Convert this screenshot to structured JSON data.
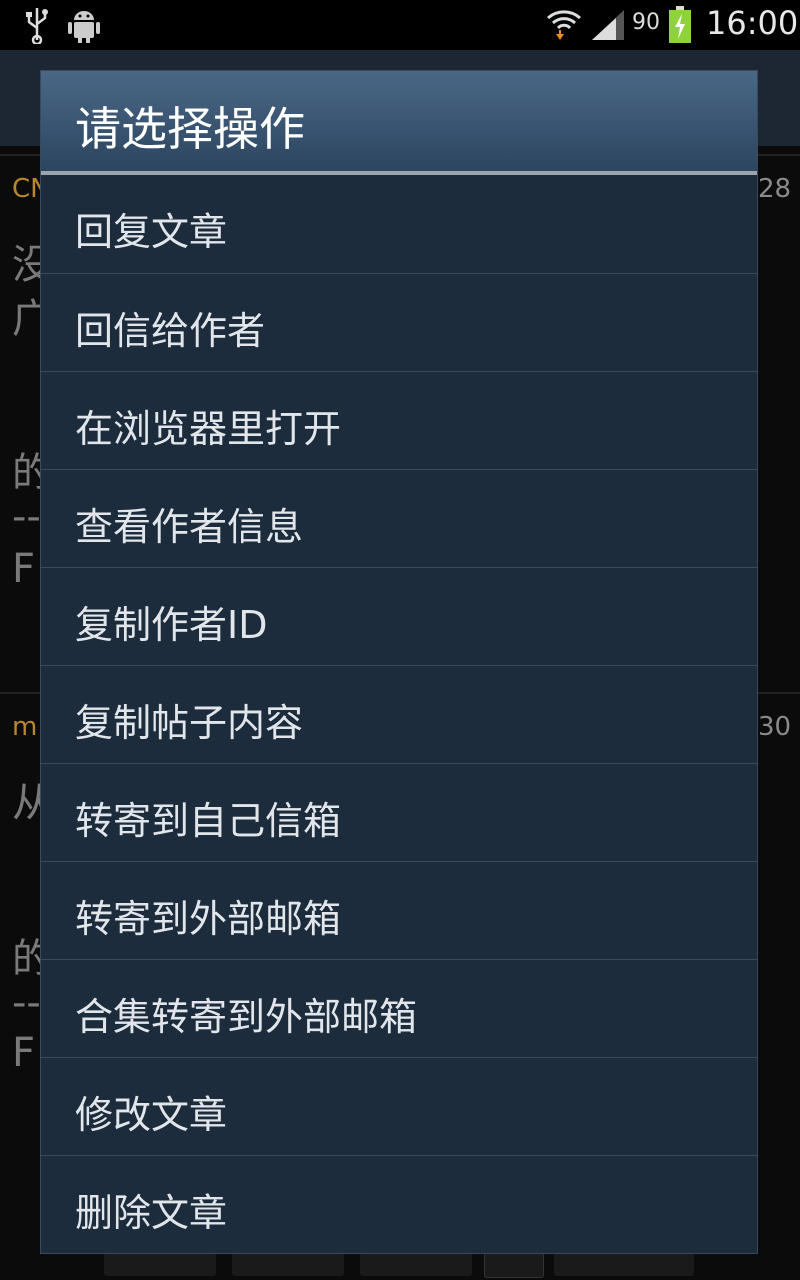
{
  "status_bar": {
    "battery_percent": "90",
    "time": "16:00"
  },
  "background": {
    "row1_author": "CN",
    "row1_time": "28",
    "row1_text_a": "没",
    "row1_text_b": "广",
    "row1_text_c": "的",
    "row1_text_d": "--",
    "row1_text_e": "F",
    "row2_author": "m",
    "row2_time": "30",
    "row2_text_a": "从",
    "row2_text_c": "的",
    "row2_text_d": "--",
    "row2_text_e": "F"
  },
  "dialog": {
    "title": "请选择操作",
    "items": [
      {
        "label": "回复文章"
      },
      {
        "label": "回信给作者"
      },
      {
        "label": "在浏览器里打开"
      },
      {
        "label": "查看作者信息"
      },
      {
        "label": "复制作者ID"
      },
      {
        "label": "复制帖子内容"
      },
      {
        "label": "转寄到自己信箱"
      },
      {
        "label": "转寄到外部邮箱"
      },
      {
        "label": "合集转寄到外部邮箱"
      },
      {
        "label": "修改文章"
      },
      {
        "label": "删除文章"
      }
    ]
  },
  "colors": {
    "dialog_bg": "#1d2c3c",
    "title_bg": "#3d5a78",
    "text": "#e2e6ea",
    "author_accent": "#b8862b"
  }
}
